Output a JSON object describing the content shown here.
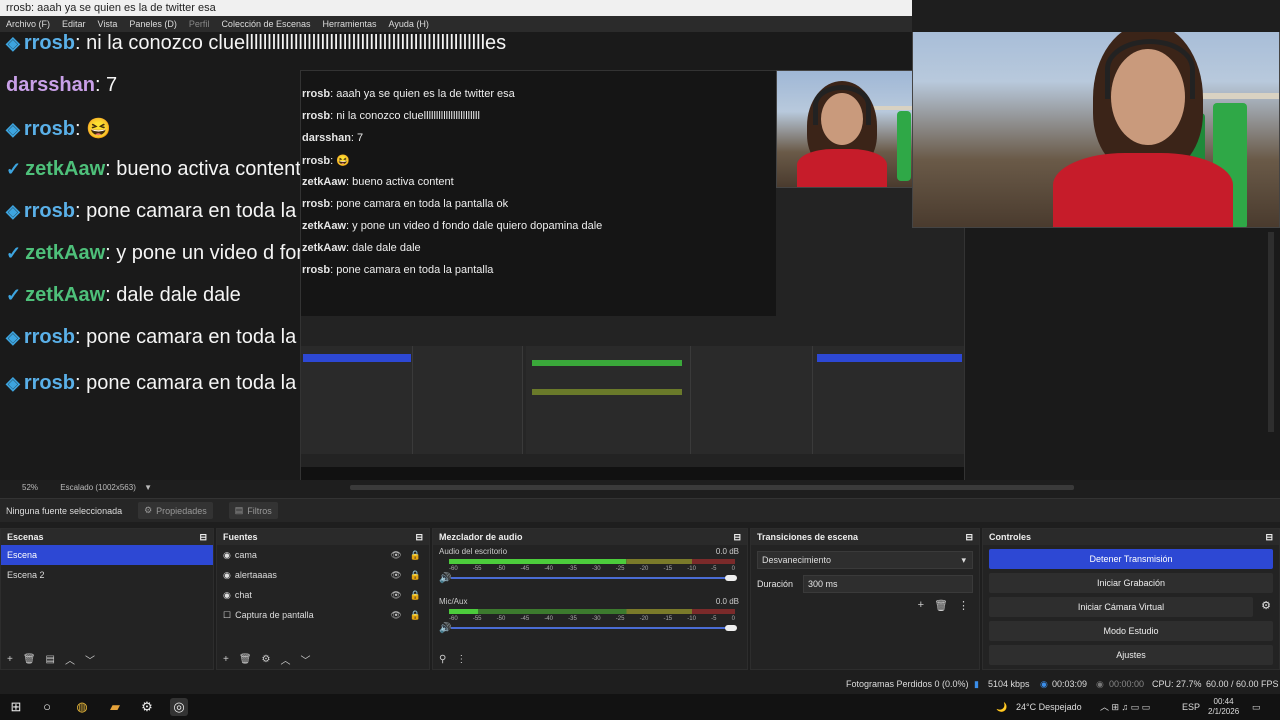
{
  "window": {
    "title": "rrosb: aaah ya se quien es la de twitter esa"
  },
  "menu": [
    "Archivo (F)",
    "Editar",
    "Vista",
    "Paneles (D)",
    "Perfil",
    "Colección de Escenas",
    "Herramientas",
    "Ayuda (H)"
  ],
  "chat": [
    {
      "user": "rrosb",
      "msg": ": ni la conozco cluelllllllllllllllllllllllllllllllllllllllllllllllllllllles"
    },
    {
      "user": "darsshan",
      "msg": ": 7"
    },
    {
      "user": "rrosb",
      "msg": ": 😆"
    },
    {
      "user": "zetkAaw",
      "msg": ": bueno activa content"
    },
    {
      "user": "rrosb",
      "msg": ": pone camara en toda la pantalla ok"
    },
    {
      "user": "zetkAaw",
      "msg": ": y pone un video d fondo dale quiero dopamina dale"
    },
    {
      "user": "zetkAaw",
      "msg": ": dale dale dale"
    },
    {
      "user": "rrosb",
      "msg": ": pone camara en toda la pantalla"
    },
    {
      "user": "rrosb",
      "msg": ": pone camara en toda la pantalla"
    }
  ],
  "nested_chat": [
    {
      "user": "rrosb",
      "msg": ": aaah ya se quien es la de twitter esa"
    },
    {
      "user": "rrosb",
      "msg": ": ni la conozco cluelllllllllllllllllllllll"
    },
    {
      "user": "darsshan",
      "msg": ": 7"
    },
    {
      "user": "rrosb",
      "msg": ": 😆"
    },
    {
      "user": "zetkAaw",
      "msg": ": bueno activa content"
    },
    {
      "user": "rrosb",
      "msg": ": pone camara en toda la pantalla ok"
    },
    {
      "user": "zetkAaw",
      "msg": ": y pone un video d fondo dale quiero dopamina dale"
    },
    {
      "user": "zetkAaw",
      "msg": ": dale dale dale"
    },
    {
      "user": "rrosb",
      "msg": ": pone camara en toda la pantalla"
    }
  ],
  "preview_status": {
    "zoom": "52%",
    "scale": "Escalado (1002x563)"
  },
  "source_bar": {
    "no_source": "Ninguna fuente seleccionada",
    "properties": "Propiedades",
    "filters": "Filtros"
  },
  "scenes": {
    "title": "Escenas",
    "items": [
      "Escena",
      "Escena 2"
    ]
  },
  "sources": {
    "title": "Fuentes",
    "items": [
      {
        "name": "cama",
        "icon": "camera-icon"
      },
      {
        "name": "alertaaaas",
        "icon": "browser-icon"
      },
      {
        "name": "chat",
        "icon": "browser-icon"
      },
      {
        "name": "Captura de pantalla",
        "icon": "display-icon"
      }
    ]
  },
  "mixer": {
    "title": "Mezclador de audio",
    "channels": [
      {
        "name": "Audio del escritorio",
        "db": "0.0 dB",
        "level": 0.62,
        "volume": 1.0
      },
      {
        "name": "Mic/Aux",
        "db": "0.0 dB",
        "level": 0.1,
        "volume": 1.0
      }
    ],
    "scale": [
      "-60",
      "-55",
      "-50",
      "-45",
      "-40",
      "-35",
      "-30",
      "-25",
      "-20",
      "-15",
      "-10",
      "-5",
      "0"
    ]
  },
  "transitions": {
    "title": "Transiciones de escena",
    "selected": "Desvanecimiento",
    "duration_label": "Duración",
    "duration_value": "300 ms"
  },
  "controls": {
    "title": "Controles",
    "stop_stream": "Detener Transmisión",
    "start_recording": "Iniciar Grabación",
    "start_virtual_cam": "Iniciar Cámara Virtual",
    "studio_mode": "Modo Estudio",
    "settings": "Ajustes"
  },
  "status": {
    "dropped_frames": "Fotogramas Perdidos 0 (0.0%)",
    "bitrate": "5104 kbps",
    "stream_time": "00:03:09",
    "rec_time": "00:00:00",
    "cpu": "CPU: 27.7%",
    "fps": "60.00 / 60.00 FPS"
  },
  "taskbar": {
    "weather": "24°C  Despejado",
    "lang": "ESP",
    "time": "00:44",
    "date": "2/1/2026"
  },
  "colors": {
    "accent": "#2d48d4",
    "meter_green": "#4ccc3c",
    "background": "#1e1e1e"
  }
}
